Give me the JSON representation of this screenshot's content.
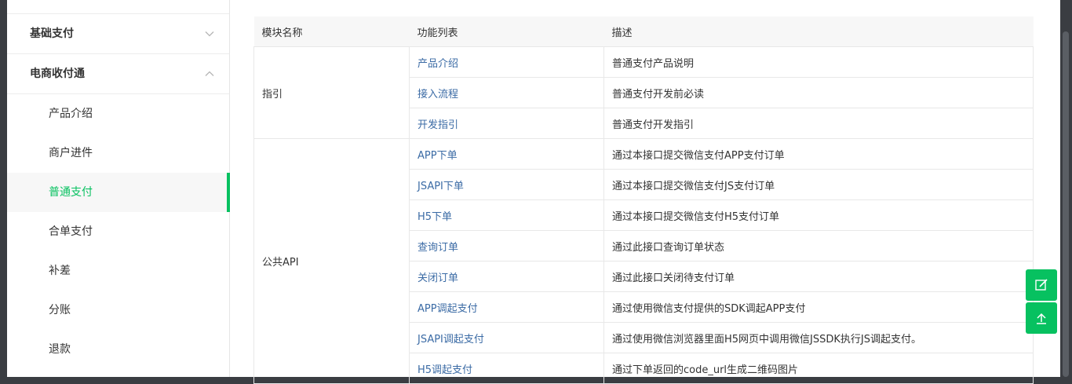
{
  "sidebar": {
    "groups": [
      {
        "label": "基础支付",
        "expanded": false
      },
      {
        "label": "电商收付通",
        "expanded": true
      }
    ],
    "items": [
      {
        "label": "产品介绍"
      },
      {
        "label": "商户进件"
      },
      {
        "label": "普通支付",
        "active": true
      },
      {
        "label": "合单支付"
      },
      {
        "label": "补差"
      },
      {
        "label": "分账"
      },
      {
        "label": "退款"
      }
    ]
  },
  "table": {
    "headers": [
      "模块名称",
      "功能列表",
      "描述"
    ],
    "rows": [
      {
        "module": "指引",
        "feature": "产品介绍",
        "desc": "普通支付产品说明"
      },
      {
        "feature": "接入流程",
        "desc": "普通支付开发前必读"
      },
      {
        "feature": "开发指引",
        "desc": "普通支付开发指引"
      },
      {
        "module": "公共API",
        "feature": "APP下单",
        "desc": "通过本接口提交微信支付APP支付订单"
      },
      {
        "feature": "JSAPI下单",
        "desc": "通过本接口提交微信支付JS支付订单"
      },
      {
        "feature": "H5下单",
        "desc": "通过本接口提交微信支付H5支付订单"
      },
      {
        "feature": "查询订单",
        "desc": "通过此接口查询订单状态"
      },
      {
        "feature": "关闭订单",
        "desc": "通过此接口关闭待支付订单"
      },
      {
        "feature": "APP调起支付",
        "desc": "通过使用微信支付提供的SDK调起APP支付"
      },
      {
        "feature": "JSAPI调起支付",
        "desc": "通过使用微信浏览器里面H5网页中调用微信JSSDK执行JS调起支付。"
      },
      {
        "feature": "H5调起支付",
        "desc": "通过下单返回的code_url生成二维码图片"
      }
    ]
  },
  "floating_buttons": [
    {
      "icon": "edit-icon"
    },
    {
      "icon": "back-to-top-icon"
    }
  ],
  "colors": {
    "accent": "#07c160",
    "link": "#3b6ba5",
    "header_bg": "#f7f7f7"
  }
}
